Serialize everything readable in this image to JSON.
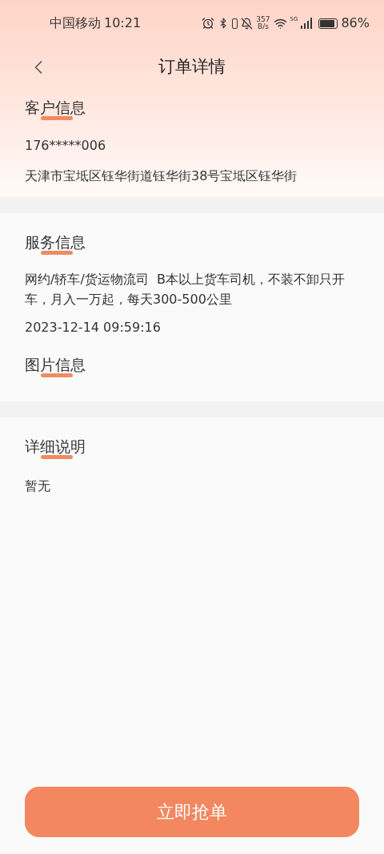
{
  "status_bar": {
    "carrier": "中国移动",
    "time": "10:21",
    "net_speed": [
      "357",
      "B/s"
    ],
    "network": "5G",
    "battery": "86%"
  },
  "header": {
    "title": "订单详情"
  },
  "sections": [
    {
      "title": "客户信息",
      "lines": [
        "176*****006",
        "天津市宝坻区钰华街道钰华街38号宝坻区钰华街"
      ]
    },
    {
      "title": "服务信息",
      "lines": [
        "网约/轿车/货运物流司  B本以上货车司机，不装不卸只开车，月入一万起，每天300-500公里",
        "2023-12-14 09:59:16"
      ],
      "subtitle": "图片信息"
    },
    {
      "title": "详细说明",
      "lines": [
        "暂无"
      ]
    }
  ],
  "action_button": "立即抢单"
}
